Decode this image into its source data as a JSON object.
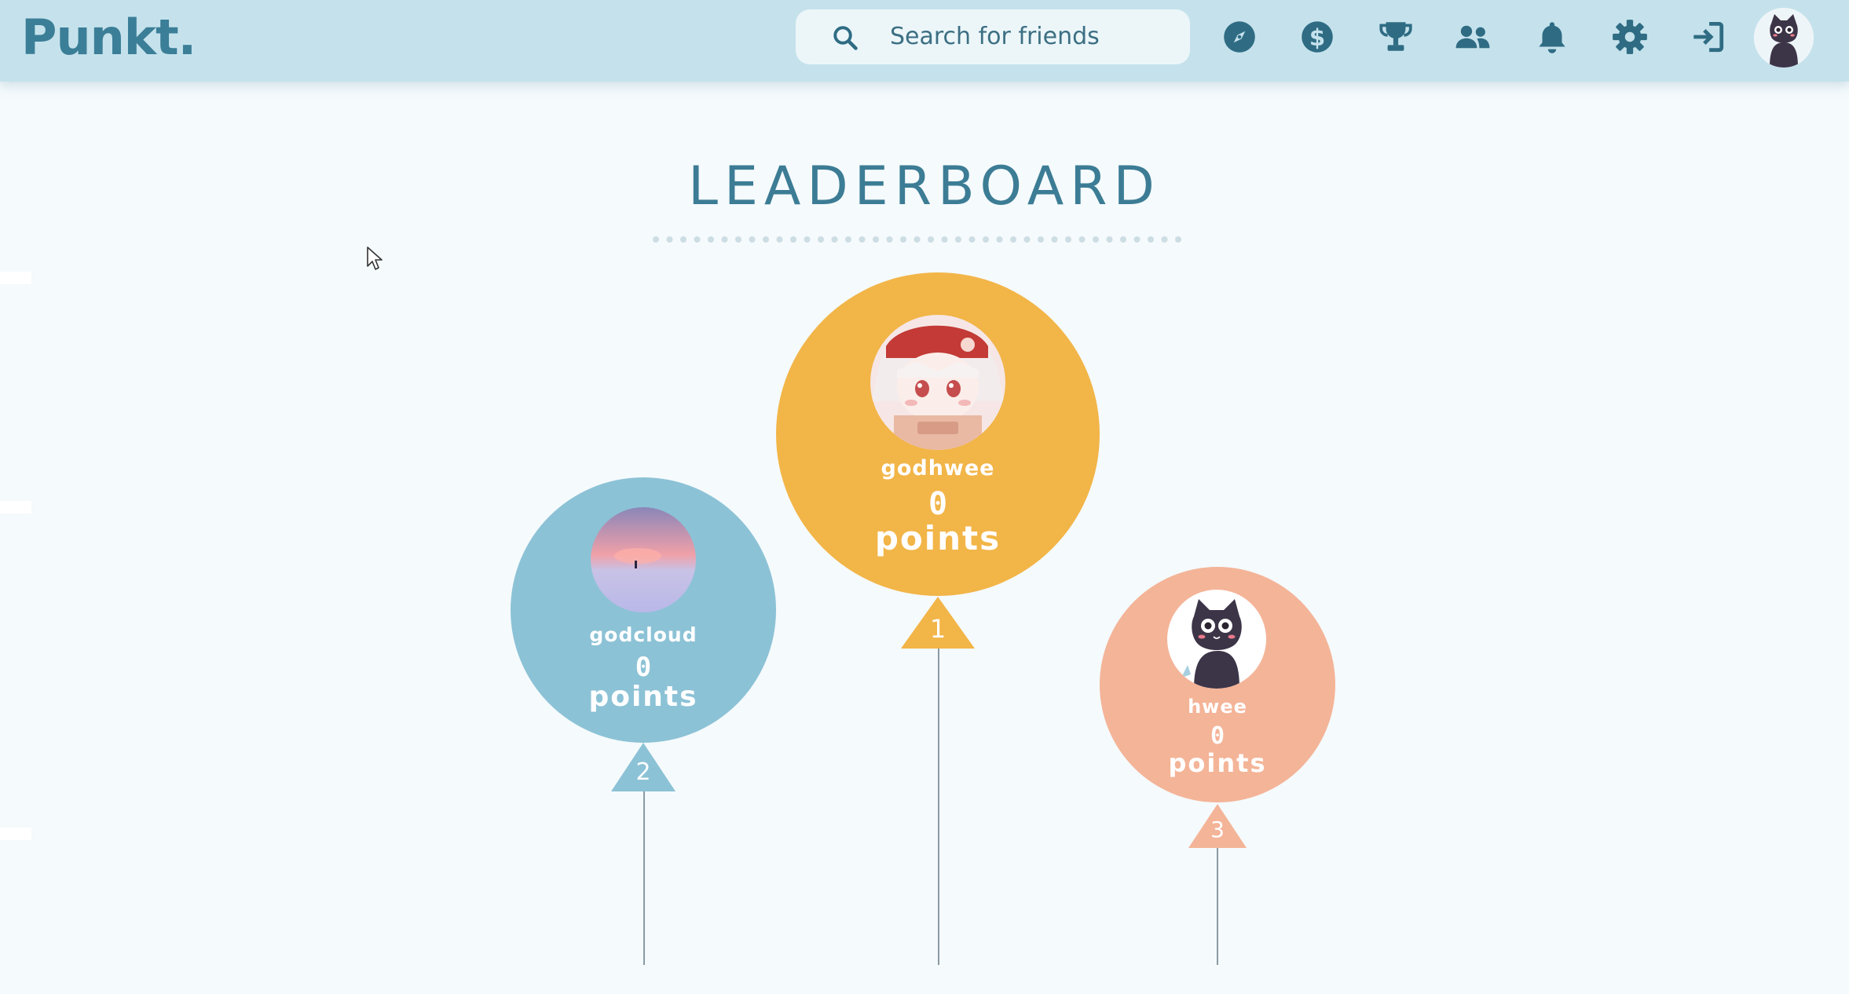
{
  "app": {
    "name": "Punkt."
  },
  "search": {
    "placeholder": "Search for friends"
  },
  "nav": {
    "icons": [
      "compass-icon",
      "dollar-icon",
      "trophy-icon",
      "friends-icon",
      "bell-icon",
      "gear-icon",
      "logout-icon"
    ]
  },
  "page": {
    "title": "LEADERBOARD"
  },
  "leaderboard": [
    {
      "rank": "1",
      "username": "godhwee",
      "points": "0",
      "unit": "points",
      "color": "#f2b548"
    },
    {
      "rank": "2",
      "username": "godcloud",
      "points": "0",
      "unit": "points",
      "color": "#8cc2d6"
    },
    {
      "rank": "3",
      "username": "hwee",
      "points": "0",
      "unit": "points",
      "color": "#f4b498"
    }
  ],
  "colors": {
    "nav_bg": "#c5e2ec",
    "accent": "#3b7e97",
    "page_bg": "#f5fafc"
  }
}
